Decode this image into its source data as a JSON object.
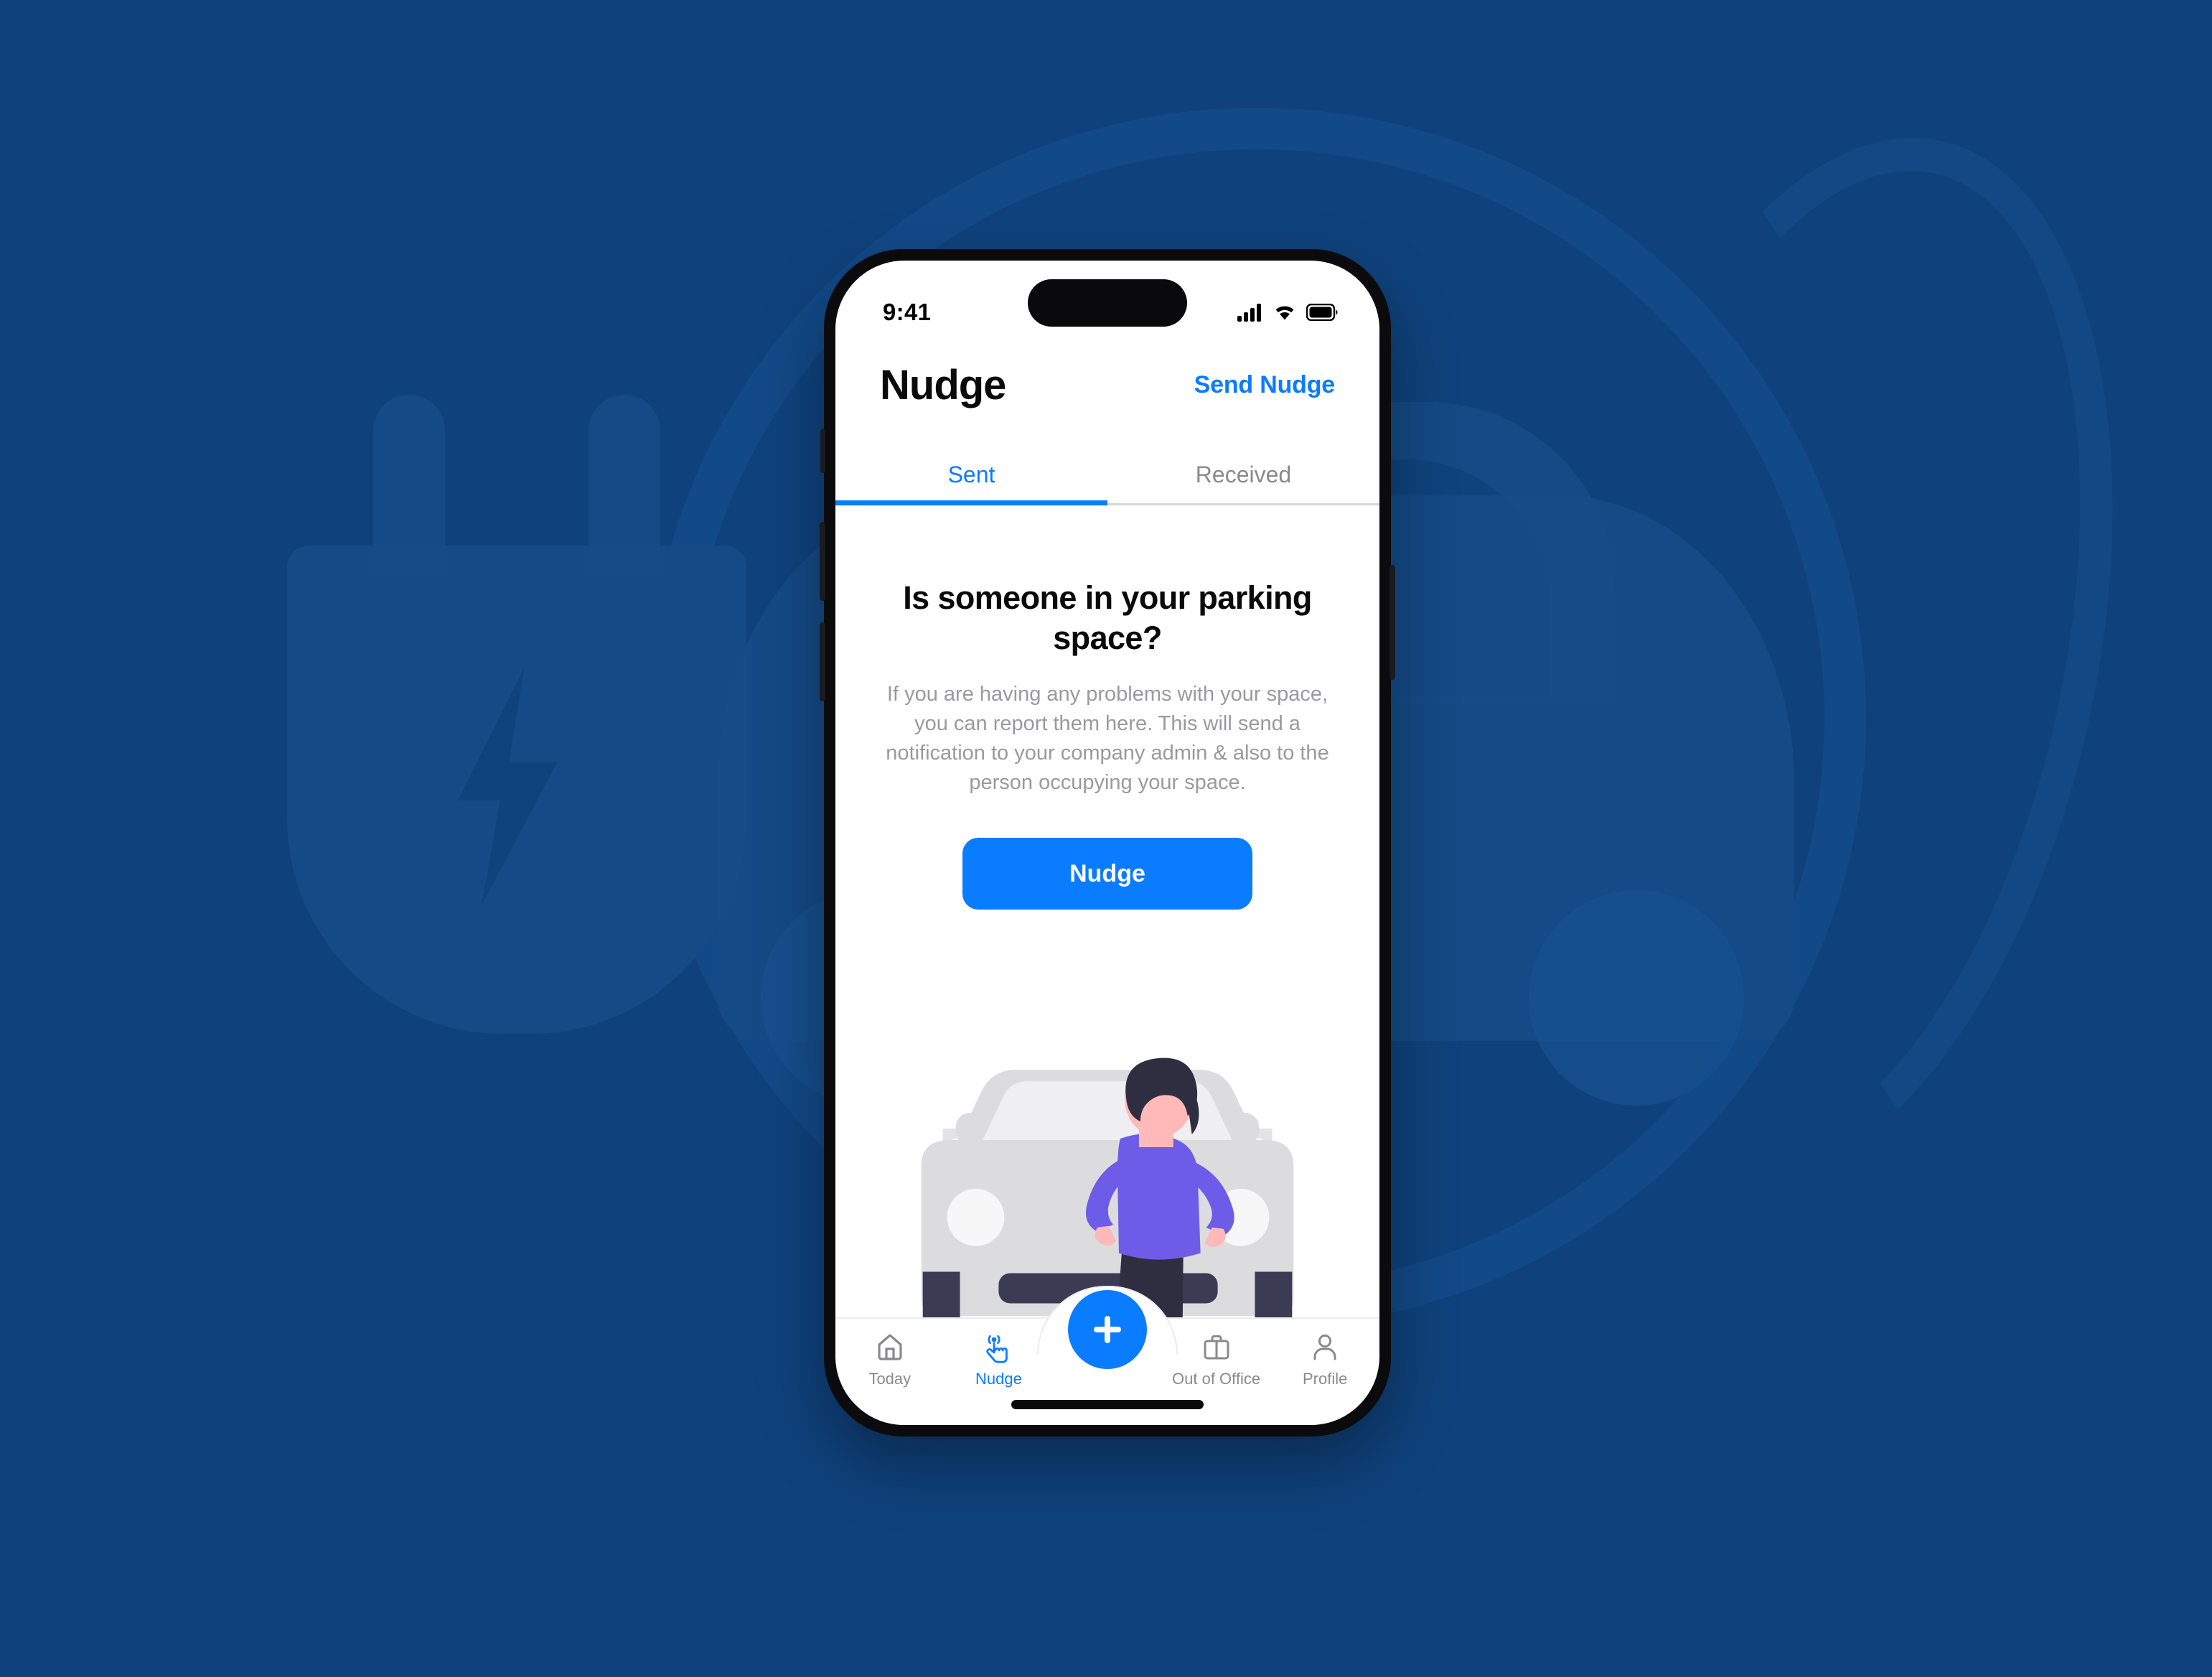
{
  "background": {
    "color": "#0F427C",
    "watermark_color": "#154B87",
    "watermark_icons": [
      "ev-plug-icon",
      "car-watermark",
      "circle-ring-watermark"
    ]
  },
  "phone": {
    "status_bar": {
      "time": "9:41",
      "icons": [
        "cellular-signal-icon",
        "wifi-icon",
        "battery-icon"
      ]
    },
    "home_indicator": true
  },
  "nav": {
    "title": "Nudge",
    "action_label": "Send Nudge",
    "action_color": "#0A7CFF"
  },
  "tabs": {
    "items": [
      {
        "label": "Sent",
        "active": true
      },
      {
        "label": "Received",
        "active": false
      }
    ],
    "active_color": "#0A7CFF",
    "inactive_color": "#8A8A8E"
  },
  "main": {
    "headline": "Is someone in your parking space?",
    "body": "If you are having any problems with your space, you can report them here. This will send a notification to your company admin & also to the person occupying your space.",
    "cta_label": "Nudge",
    "cta_color": "#0A7CFF",
    "illustration": {
      "name": "person-standing-in-front-of-car-illustration",
      "car_color": "#DCDCDE",
      "windshield_color": "#EFEFF1",
      "tire_color": "#3C3B54",
      "shirt_color": "#6C5CE7",
      "pants_color": "#2F2E41",
      "skin_color": "#FFB9B9",
      "hair_color": "#2F2E41",
      "parking_line_color": "#E4E4E6"
    }
  },
  "tabbar": {
    "items": [
      {
        "label": "Today",
        "icon": "home-icon",
        "active": false
      },
      {
        "label": "Nudge",
        "icon": "tap-hand-icon",
        "active": true
      },
      {
        "label": "Out of Office",
        "icon": "briefcase-icon",
        "active": false
      },
      {
        "label": "Profile",
        "icon": "person-icon",
        "active": false
      }
    ],
    "fab": {
      "icon": "plus-icon",
      "color": "#0A7CFF"
    },
    "active_color": "#0A7CFF",
    "inactive_color": "#8A8A8E"
  }
}
